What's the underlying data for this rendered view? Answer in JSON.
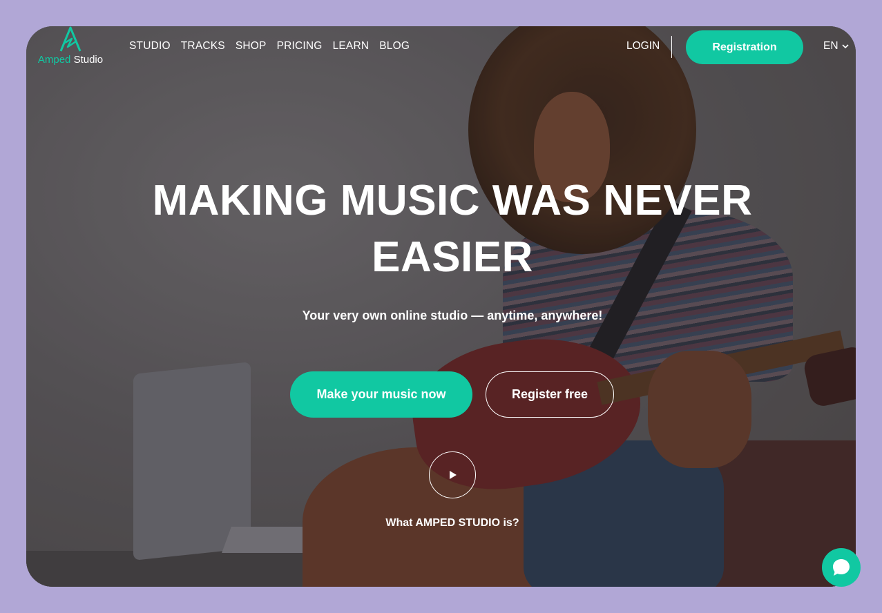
{
  "brand": {
    "name_part1": "Amped",
    "name_part2": " Studio",
    "accent_color": "#11c8a2",
    "logo_icon": "amped-logo-icon"
  },
  "nav": {
    "items": [
      {
        "label": "STUDIO"
      },
      {
        "label": "TRACKS"
      },
      {
        "label": "SHOP"
      },
      {
        "label": "PRICING"
      },
      {
        "label": "LEARN"
      },
      {
        "label": "BLOG"
      }
    ],
    "login_label": "LOGIN",
    "registration_label": "Registration",
    "language": "EN",
    "language_icon": "chevron-down-icon"
  },
  "hero": {
    "title_line1": "MAKING MUSIC WAS NEVER",
    "title_line2": "EASIER",
    "subtitle": "Your very own online studio — anytime, anywhere!",
    "primary_cta": "Make your music now",
    "secondary_cta": "Register free",
    "video_icon": "play-icon",
    "video_label": "What AMPED STUDIO is?"
  },
  "chat": {
    "icon": "chat-bubble-icon"
  },
  "colors": {
    "page_background": "#b1a7d6",
    "accent": "#11c8a2",
    "text": "#ffffff"
  }
}
